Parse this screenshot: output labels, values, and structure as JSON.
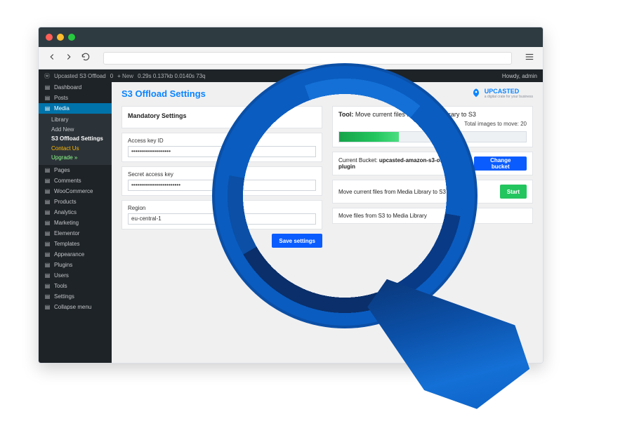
{
  "adminbar": {
    "site": "Upcasted S3 Offload",
    "badges": "0",
    "new": "New",
    "stats": "0.29s  0.137kb  0.0140s  73q",
    "greeting": "Howdy, admin"
  },
  "sidebar": {
    "items": [
      {
        "label": "Dashboard",
        "icon": "dashboard-icon"
      },
      {
        "label": "Posts",
        "icon": "pin-icon"
      },
      {
        "label": "Media",
        "icon": "media-icon",
        "active": true,
        "children": [
          {
            "label": "Library"
          },
          {
            "label": "Add New"
          },
          {
            "label": "S3 Offload Settings",
            "on": true
          },
          {
            "label": "Contact Us",
            "cls": "contact"
          },
          {
            "label": "Upgrade »",
            "cls": "upgrade"
          }
        ]
      },
      {
        "label": "Pages",
        "icon": "page-icon"
      },
      {
        "label": "Comments",
        "icon": "comment-icon"
      },
      {
        "label": "WooCommerce",
        "icon": "woo-icon"
      },
      {
        "label": "Products",
        "icon": "box-icon"
      },
      {
        "label": "Analytics",
        "icon": "chart-icon"
      },
      {
        "label": "Marketing",
        "icon": "megaphone-icon"
      },
      {
        "label": "Elementor",
        "icon": "elementor-icon"
      },
      {
        "label": "Templates",
        "icon": "templates-icon"
      },
      {
        "label": "Appearance",
        "icon": "brush-icon"
      },
      {
        "label": "Plugins",
        "icon": "plug-icon"
      },
      {
        "label": "Users",
        "icon": "users-icon"
      },
      {
        "label": "Tools",
        "icon": "wrench-icon"
      },
      {
        "label": "Settings",
        "icon": "sliders-icon"
      },
      {
        "label": "Collapse menu",
        "icon": "collapse-icon"
      }
    ]
  },
  "page": {
    "title": "S3 Offload Settings",
    "brand": "UPCASTED",
    "brand_sub": "a digital crate for your business"
  },
  "left_panel": {
    "heading": "Mandatory Settings",
    "fields": {
      "access_key_label": "Access key ID",
      "access_key_value": "••••••••••••••••••••",
      "secret_key_label": "Secret access key",
      "secret_key_value": "•••••••••••••••••••••••••",
      "region_label": "Region",
      "region_value": "eu-central-1"
    },
    "save_btn": "Save settings"
  },
  "right_panel": {
    "tool_prefix": "Tool:",
    "tool_title": "Move current files from Media Library to S3",
    "total_text": "Total images to move: 20",
    "bucket_label": "Current Bucket:",
    "bucket_name": "upcasted-amazon-s3-offload-plugin",
    "change_btn": "Change bucket",
    "move_to_s3": "Move current files from Media Library to S3",
    "start_btn": "Start",
    "move_from_s3": "Move files from S3 to Media Library"
  }
}
